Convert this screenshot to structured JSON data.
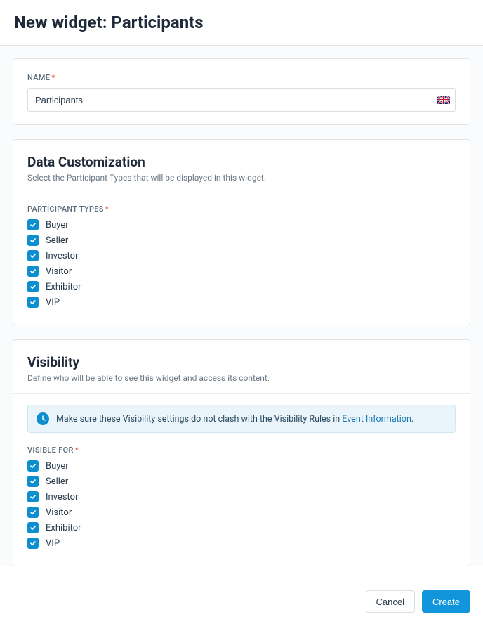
{
  "header": {
    "title": "New widget: Participants"
  },
  "name_section": {
    "label": "NAME",
    "value": "Participants",
    "locale_flag": "uk-flag-icon"
  },
  "data_customization": {
    "title": "Data Customization",
    "description": "Select the Participant Types that will be displayed in this widget.",
    "types_label": "PARTICIPANT TYPES",
    "types": [
      {
        "label": "Buyer",
        "checked": true
      },
      {
        "label": "Seller",
        "checked": true
      },
      {
        "label": "Investor",
        "checked": true
      },
      {
        "label": "Visitor",
        "checked": true
      },
      {
        "label": "Exhibitor",
        "checked": true
      },
      {
        "label": "VIP",
        "checked": true
      }
    ]
  },
  "visibility": {
    "title": "Visibility",
    "description": "Define who will be able to see this widget and access its content.",
    "info_text": "Make sure these Visibility settings do not clash with the Visibility Rules in ",
    "info_link_label": "Event Information",
    "info_suffix": ".",
    "visible_for_label": "VISIBLE FOR",
    "visible_for": [
      {
        "label": "Buyer",
        "checked": true
      },
      {
        "label": "Seller",
        "checked": true
      },
      {
        "label": "Investor",
        "checked": true
      },
      {
        "label": "Visitor",
        "checked": true
      },
      {
        "label": "Exhibitor",
        "checked": true
      },
      {
        "label": "VIP",
        "checked": true
      }
    ]
  },
  "footer": {
    "cancel": "Cancel",
    "create": "Create"
  },
  "colors": {
    "accent": "#1296db",
    "checkbox": "#0d8ecf",
    "required": "#e74c3c"
  }
}
